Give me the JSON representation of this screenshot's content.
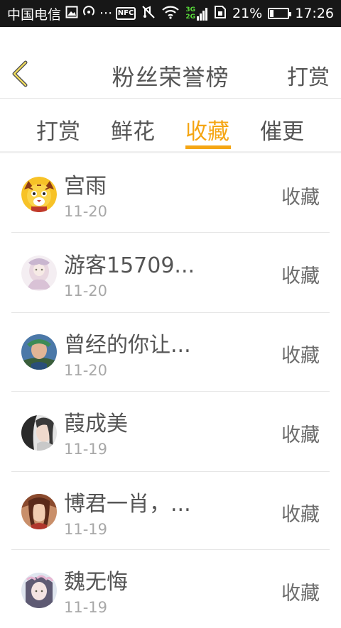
{
  "status_bar": {
    "carrier": "中国电信",
    "dots": "···",
    "signal_label_top": "3G",
    "signal_label_bottom": "2G",
    "battery": "21%",
    "battery_level": 0.21,
    "time": "17:26"
  },
  "header": {
    "title": "粉丝荣誉榜",
    "action_label": "打赏"
  },
  "tabs": [
    {
      "label": "打赏",
      "active": false
    },
    {
      "label": "鲜花",
      "active": false
    },
    {
      "label": "收藏",
      "active": true
    },
    {
      "label": "催更",
      "active": false
    }
  ],
  "list": [
    {
      "name": "宫雨",
      "date": "11-20",
      "action": "收藏"
    },
    {
      "name": "游客15709...",
      "date": "11-20",
      "action": "收藏"
    },
    {
      "name": "曾经的你让...",
      "date": "11-20",
      "action": "收藏"
    },
    {
      "name": "葭成美",
      "date": "11-19",
      "action": "收藏"
    },
    {
      "name": "博君一肖，...",
      "date": "11-19",
      "action": "收藏"
    },
    {
      "name": "魏无悔",
      "date": "11-19",
      "action": "收藏"
    }
  ],
  "colors": {
    "accent": "#f5a614",
    "status_bar": "#171717",
    "text": "#555555",
    "muted": "#a8a8a8"
  }
}
